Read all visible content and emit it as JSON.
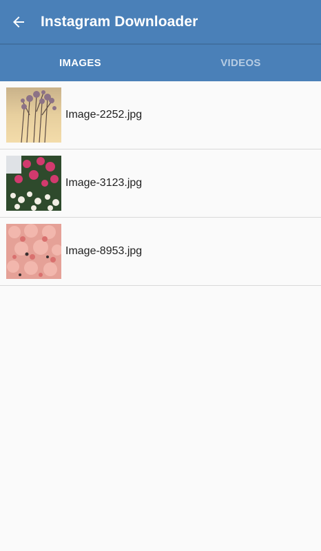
{
  "app": {
    "title": "Instagram Downloader",
    "accent_color": "#4a80b8"
  },
  "tabs": [
    {
      "label": "IMAGES",
      "active": true
    },
    {
      "label": "VIDEOS",
      "active": false
    }
  ],
  "images": [
    {
      "name": "Image-2252.jpg"
    },
    {
      "name": "Image-3123.jpg"
    },
    {
      "name": "Image-8953.jpg"
    }
  ]
}
